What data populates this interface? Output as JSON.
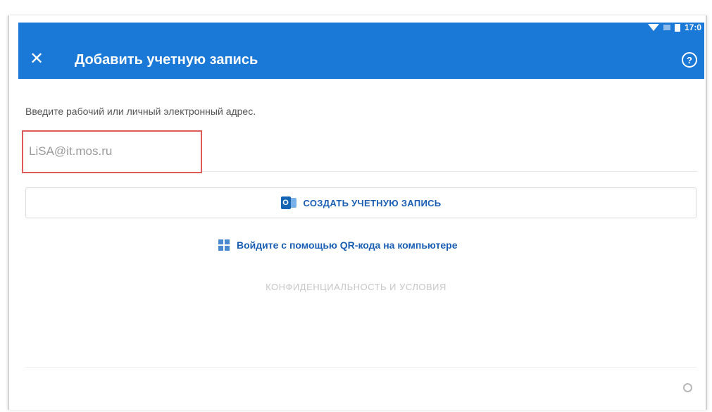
{
  "header": {
    "title": "Добавить учетную запись",
    "status_time": "17:0",
    "background_color": "#1a78d7"
  },
  "main": {
    "instruction": "Введите рабочий или личный электронный адрес.",
    "email_value": "LiSA@it.mos.ru",
    "create_account_label": "СОЗДАТЬ УЧЕТНУЮ ЗАПИСЬ",
    "qr_login_label": "Войдите с помощью QR-кода на компьютере",
    "privacy_label": "КОНФИДЕНЦИАЛЬНОСТЬ И УСЛОВИЯ"
  },
  "icons": {
    "close": "close-icon",
    "help": "help-icon",
    "outlook": "outlook-icon",
    "qr": "qr-code-icon",
    "loading": "loading-icon"
  },
  "colors": {
    "accent": "#1a5fb4",
    "highlight_border": "#e05a5a"
  }
}
